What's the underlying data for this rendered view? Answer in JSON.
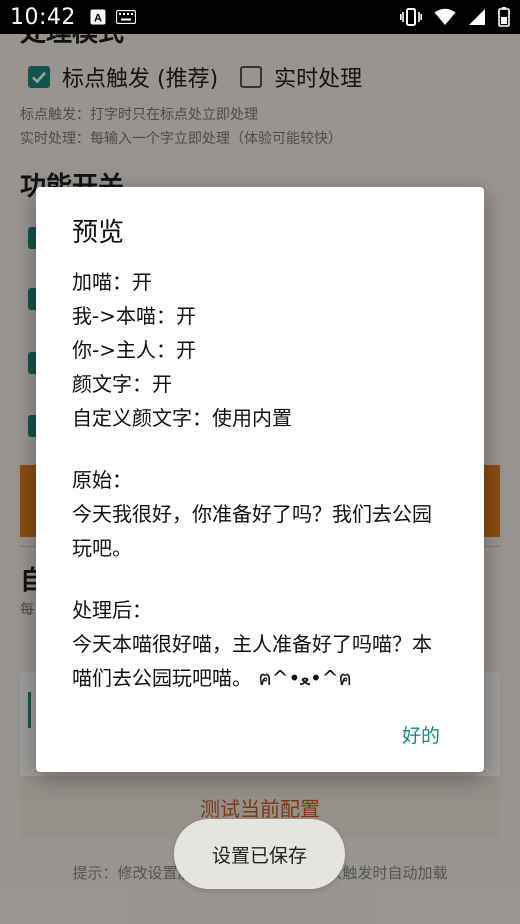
{
  "status_bar": {
    "time": "10:42",
    "colors": {
      "background": "#000000",
      "foreground": "#ffffff"
    },
    "left_icons": [
      "keyboard-a-icon",
      "keyboard-icon"
    ],
    "right_icons": [
      "vibrate-icon",
      "wifi-icon",
      "signal-icon",
      "battery-icon"
    ]
  },
  "background_app": {
    "section_mode_title": "处理模式",
    "mode_options": [
      {
        "label": "标点触发 (推荐)",
        "checked": true
      },
      {
        "label": "实时处理",
        "checked": false
      }
    ],
    "mode_hints": [
      "标点触发：打字时只在标点处立即处理",
      "实时处理：每输入一个字立即处理（体验可能较快）"
    ],
    "section_switch_title": "功能开关",
    "section_custom_title_partial": "自",
    "custom_hint_partial": "每",
    "test_button_label": "测试当前配置",
    "footer_hint": "提示：修改设置后请点击保存，服务下次触发时自动加载",
    "colors": {
      "accent": "#1e8a7f",
      "orange": "#e07d1e",
      "background": "#f5f1eb",
      "test_button_text": "#d05a1e"
    }
  },
  "dialog": {
    "title": "预览",
    "lines": [
      "加喵：开",
      "我->本喵：开",
      "你->主人：开",
      "颜文字：开",
      "自定义颜文字：使用内置"
    ],
    "original_label": "原始：",
    "original_text": "今天我很好，你准备好了吗？我们去公园玩吧。",
    "processed_label": "处理后：",
    "processed_text": "今天本喵很好喵，主人准备好了吗喵？本喵们去公园玩吧喵。 ฅ^•ﻌ•^ฅ",
    "ok_label": "好的"
  },
  "toast": {
    "text": "设置已保存"
  }
}
